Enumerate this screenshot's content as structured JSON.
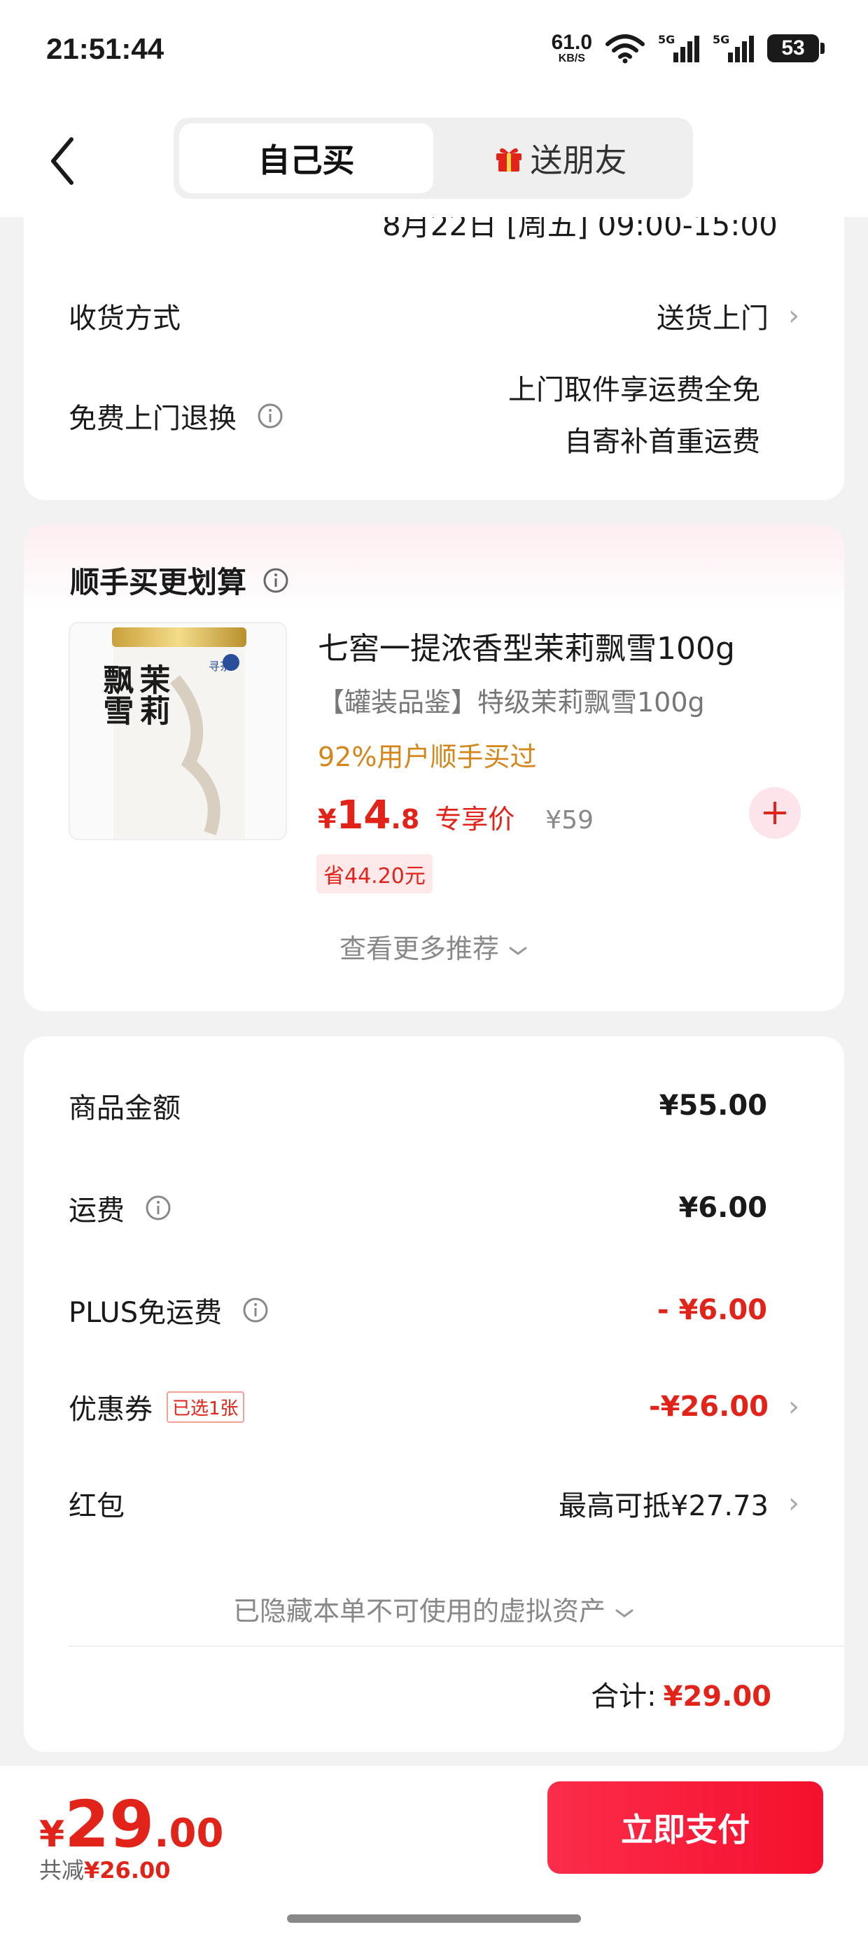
{
  "status": {
    "time": "21:51:44",
    "net_speed": "61.0",
    "net_unit": "KB/S",
    "battery": "53",
    "signal1": "5G",
    "signal2": "5G"
  },
  "header": {
    "tab_self": "自己买",
    "tab_gift": "送朋友"
  },
  "delivery": {
    "date_partial": "8月22日 [周五] 09:00-15:00",
    "method_label": "收货方式",
    "method_value": "送货上门",
    "return_label": "免费上门退换",
    "return_line1": "上门取件享运费全免",
    "return_line2": "自寄补首重运费"
  },
  "recommend": {
    "title": "顺手买更划算",
    "product_name": "七窖一提浓香型茉莉飘雪100g",
    "product_sub": "【罐装品鉴】特级茉莉飘雪100g",
    "product_tag": "92%用户顺手买过",
    "price_symbol": "¥",
    "price_int": "14",
    "price_dec": ".8",
    "price_tag": "专享价",
    "original_price": "¥59",
    "save_badge": "省44.20元",
    "more": "查看更多推荐",
    "can_text_1": "茉莉",
    "can_text_2": "飘雪",
    "can_brand": "寻茶"
  },
  "summary": {
    "goods_label": "商品金额",
    "goods_value": "¥55.00",
    "shipping_label": "运费",
    "shipping_value": "¥6.00",
    "plus_label": "PLUS免运费",
    "plus_value": "- ¥6.00",
    "coupon_label": "优惠券",
    "coupon_tag": "已选1张",
    "coupon_value": "-¥26.00",
    "redpack_label": "红包",
    "redpack_value": "最高可抵¥27.73",
    "hidden_assets": "已隐藏本单不可使用的虚拟资产",
    "total_label": "合计:",
    "total_value": "¥29.00"
  },
  "bottom": {
    "price_symbol": "¥",
    "price_int": "29",
    "price_dec": ".00",
    "saved_label": "共减",
    "saved_value": "¥26.00",
    "pay_label": "立即支付"
  },
  "colors": {
    "accent": "#e2231a",
    "tag_orange": "#d4861b",
    "pay_start": "#fb2d4a",
    "pay_end": "#f5102d"
  }
}
